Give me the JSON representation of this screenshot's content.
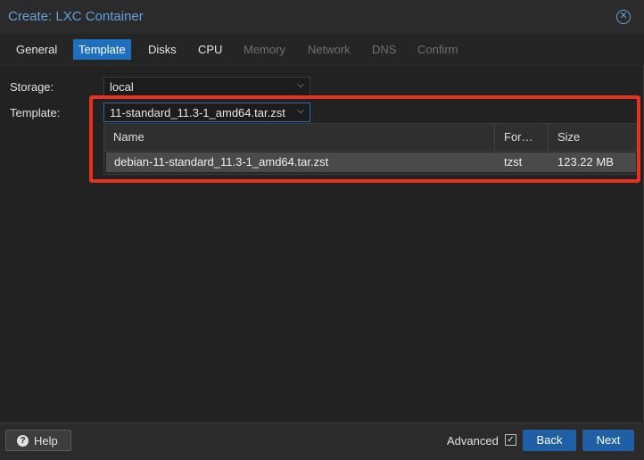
{
  "window": {
    "title": "Create: LXC Container",
    "close_icon": "close-circle-icon",
    "accent_color": "#5fa2dd"
  },
  "tabs": [
    {
      "label": "General",
      "state": "enabled"
    },
    {
      "label": "Template",
      "state": "active"
    },
    {
      "label": "Disks",
      "state": "enabled"
    },
    {
      "label": "CPU",
      "state": "enabled"
    },
    {
      "label": "Memory",
      "state": "disabled"
    },
    {
      "label": "Network",
      "state": "disabled"
    },
    {
      "label": "DNS",
      "state": "disabled"
    },
    {
      "label": "Confirm",
      "state": "disabled"
    }
  ],
  "form": {
    "storage": {
      "label": "Storage:",
      "value": "local"
    },
    "template": {
      "label": "Template:",
      "value": "11-standard_11.3-1_amd64.tar.zst"
    }
  },
  "template_picker": {
    "columns": [
      "Name",
      "For…",
      "Size"
    ],
    "rows": [
      {
        "name": "debian-11-standard_11.3-1_amd64.tar.zst",
        "format": "tzst",
        "size": "123.22 MB"
      }
    ],
    "highlight_color": "#e8321e"
  },
  "footer": {
    "help_label": "Help",
    "help_icon": "question-circle-icon",
    "advanced_label": "Advanced",
    "advanced_checked": true,
    "back_label": "Back",
    "next_label": "Next",
    "button_color": "#1f5fa6"
  }
}
